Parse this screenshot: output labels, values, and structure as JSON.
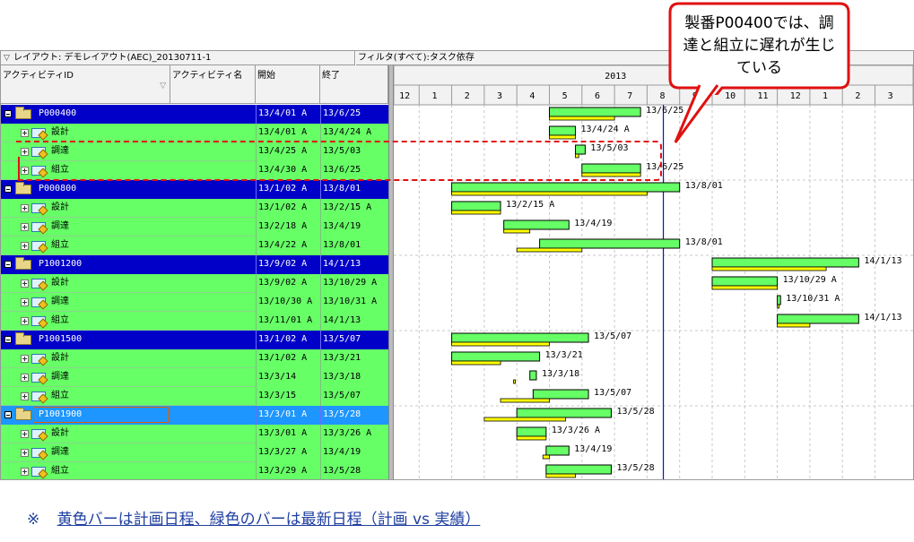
{
  "toolbar": {
    "layout_label": "レイアウト: デモレイアウト(AEC)_20130711-1",
    "filter_label": "フィルタ(すべて):タスク依存"
  },
  "columns": {
    "id": "アクティビティID",
    "name": "アクティビティ名",
    "start": "開始",
    "end": "終了"
  },
  "timeline": {
    "year": "2013",
    "months": [
      "12",
      "1",
      "2",
      "3",
      "4",
      "5",
      "6",
      "7",
      "8",
      "9",
      "10",
      "11",
      "12",
      "1",
      "2",
      "3"
    ]
  },
  "rows": [
    {
      "type": "group",
      "id": "P000400",
      "start": "13/4/01 A",
      "end": "13/6/25",
      "bar_label": "13/6/25",
      "selected": false
    },
    {
      "type": "task",
      "id": "設計",
      "start": "13/4/01 A",
      "end": "13/4/24 A",
      "bar_label": "13/4/24 A"
    },
    {
      "type": "task",
      "id": "調達",
      "start": "13/4/25 A",
      "end": "13/5/03",
      "bar_label": "13/5/03"
    },
    {
      "type": "task",
      "id": "組立",
      "start": "13/4/30 A",
      "end": "13/6/25",
      "bar_label": "13/6/25"
    },
    {
      "type": "group",
      "id": "P000800",
      "start": "13/1/02 A",
      "end": "13/8/01",
      "bar_label": "13/8/01",
      "selected": false
    },
    {
      "type": "task",
      "id": "設計",
      "start": "13/1/02 A",
      "end": "13/2/15 A",
      "bar_label": "13/2/15 A"
    },
    {
      "type": "task",
      "id": "調達",
      "start": "13/2/18 A",
      "end": "13/4/19",
      "bar_label": "13/4/19"
    },
    {
      "type": "task",
      "id": "組立",
      "start": "13/4/22 A",
      "end": "13/8/01",
      "bar_label": "13/8/01"
    },
    {
      "type": "group",
      "id": "P1001200",
      "start": "13/9/02 A",
      "end": "14/1/13",
      "bar_label": "14/1/13",
      "selected": false
    },
    {
      "type": "task",
      "id": "設計",
      "start": "13/9/02 A",
      "end": "13/10/29 A",
      "bar_label": "13/10/29 A"
    },
    {
      "type": "task",
      "id": "調達",
      "start": "13/10/30 A",
      "end": "13/10/31 A",
      "bar_label": "13/10/31 A"
    },
    {
      "type": "task",
      "id": "組立",
      "start": "13/11/01 A",
      "end": "14/1/13",
      "bar_label": "14/1/13"
    },
    {
      "type": "group",
      "id": "P1001500",
      "start": "13/1/02 A",
      "end": "13/5/07",
      "bar_label": "13/5/07",
      "selected": false
    },
    {
      "type": "task",
      "id": "設計",
      "start": "13/1/02 A",
      "end": "13/3/21",
      "bar_label": "13/3/21"
    },
    {
      "type": "task",
      "id": "調達",
      "start": "13/3/14",
      "end": "13/3/18",
      "bar_label": "13/3/18"
    },
    {
      "type": "task",
      "id": "組立",
      "start": "13/3/15",
      "end": "13/5/07",
      "bar_label": "13/5/07"
    },
    {
      "type": "group",
      "id": "P1001900",
      "start": "13/3/01 A",
      "end": "13/5/28",
      "bar_label": "13/5/28",
      "selected": true
    },
    {
      "type": "task",
      "id": "設計",
      "start": "13/3/01 A",
      "end": "13/3/26 A",
      "bar_label": "13/3/26 A"
    },
    {
      "type": "task",
      "id": "調達",
      "start": "13/3/27 A",
      "end": "13/4/19",
      "bar_label": "13/4/19"
    },
    {
      "type": "task",
      "id": "組立",
      "start": "13/3/29 A",
      "end": "13/5/28",
      "bar_label": "13/5/28"
    }
  ],
  "bars": [
    {
      "g": [
        4.0,
        6.8
      ],
      "y": [
        4.0,
        6.0
      ]
    },
    {
      "g": [
        4.0,
        4.8
      ],
      "y": [
        4.0,
        4.8
      ]
    },
    {
      "g": [
        4.8,
        5.1
      ],
      "y": [
        4.8,
        4.9
      ]
    },
    {
      "g": [
        5.0,
        6.8
      ],
      "y": [
        5.0,
        6.8
      ]
    },
    {
      "g": [
        1.0,
        8.0
      ],
      "y": [
        1.0,
        7.0
      ]
    },
    {
      "g": [
        1.0,
        2.5
      ],
      "y": [
        1.0,
        2.5
      ]
    },
    {
      "g": [
        2.6,
        4.6
      ],
      "y": [
        2.6,
        3.4
      ]
    },
    {
      "g": [
        3.7,
        8.0
      ],
      "y": [
        3.0,
        5.0
      ]
    },
    {
      "g": [
        9.0,
        13.5
      ],
      "y": [
        9.0,
        12.5
      ]
    },
    {
      "g": [
        9.0,
        11.0
      ],
      "y": [
        9.0,
        11.0
      ]
    },
    {
      "g": [
        11.0,
        11.1
      ],
      "y": [
        11.0,
        11.05
      ]
    },
    {
      "g": [
        11.0,
        13.5
      ],
      "y": [
        11.0,
        12.0
      ]
    },
    {
      "g": [
        1.0,
        5.2
      ],
      "y": [
        1.0,
        4.0
      ]
    },
    {
      "g": [
        1.0,
        3.7
      ],
      "y": [
        1.0,
        2.5
      ]
    },
    {
      "g": [
        3.4,
        3.6
      ],
      "y": [
        2.9,
        2.95
      ]
    },
    {
      "g": [
        3.5,
        5.2
      ],
      "y": [
        2.5,
        4.0
      ]
    },
    {
      "g": [
        3.0,
        5.9
      ],
      "y": [
        2.0,
        4.5
      ]
    },
    {
      "g": [
        3.0,
        3.9
      ],
      "y": [
        3.0,
        3.9
      ]
    },
    {
      "g": [
        3.9,
        4.6
      ],
      "y": [
        3.8,
        4.0
      ]
    },
    {
      "g": [
        3.9,
        5.9
      ],
      "y": [
        3.9,
        4.8
      ]
    }
  ],
  "today_month": 7.5,
  "callout": {
    "text": "製番P00400では、調達と組立に遅れが生じている"
  },
  "footnote": {
    "mark": "※",
    "text": "黄色バーは計画日程、緑色のバーは最新日程（計画 vs 実績）"
  },
  "colors": {
    "group_row": "#0000c8",
    "task_row": "#66ff66",
    "selected_row": "#1e96ff",
    "green_bar": "#66ff66",
    "yellow_bar": "#ffff00",
    "today_line": "#1010c0",
    "callout_border": "#e01010"
  }
}
